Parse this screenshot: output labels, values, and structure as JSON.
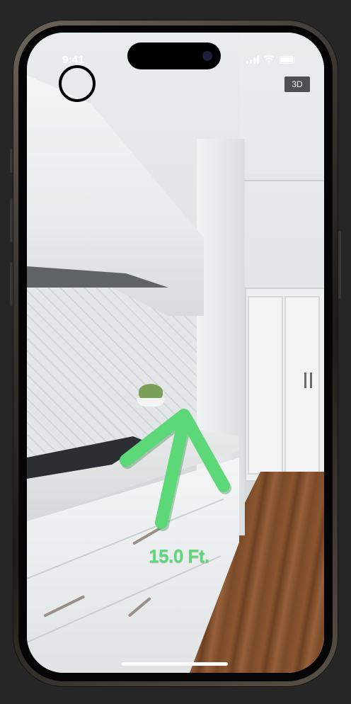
{
  "status_bar": {
    "time": "9:41"
  },
  "controls": {
    "view_mode_label": "3D"
  },
  "measurement": {
    "distance_label": "15.0 Ft.",
    "arrow_color": "#5dd879"
  },
  "icons": [
    "capture-ring-icon",
    "arrow-up-icon",
    "signal-icon",
    "wifi-icon",
    "battery-icon"
  ]
}
